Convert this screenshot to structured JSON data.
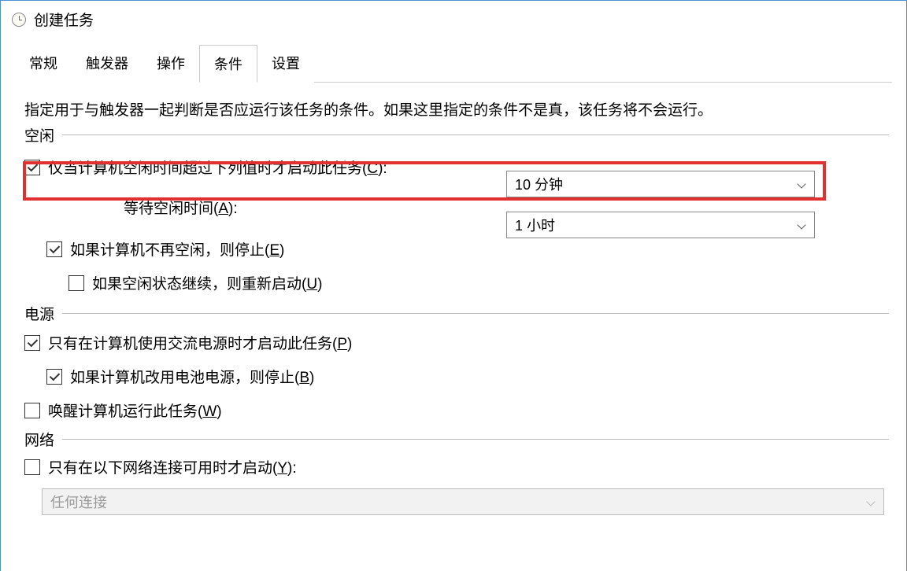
{
  "window": {
    "title": "创建任务"
  },
  "tabs": {
    "general": "常规",
    "triggers": "触发器",
    "actions": "操作",
    "conditions": "条件",
    "settings": "设置"
  },
  "active_tab": "conditions",
  "description": "指定用于与触发器一起判断是否应运行该任务的条件。如果这里指定的条件不是真，该任务将不会运行。",
  "sections": {
    "idle": {
      "label": "空闲"
    },
    "power": {
      "label": "电源"
    },
    "network": {
      "label": "网络"
    }
  },
  "options": {
    "idle_start": {
      "checked": true,
      "label_pre": "仅当计算机空闲时间超过下列值时才启动此任务(",
      "key": "C",
      "label_post": "):",
      "value": "10 分钟"
    },
    "idle_wait": {
      "label_pre": "等待空闲时间(",
      "key": "A",
      "label_post": "):",
      "value": "1 小时"
    },
    "idle_stop": {
      "checked": true,
      "label_pre": "如果计算机不再空闲，则停止(",
      "key": "E",
      "label_post": ")"
    },
    "idle_restart": {
      "checked": false,
      "label_pre": "如果空闲状态继续，则重新启动(",
      "key": "U",
      "label_post": ")"
    },
    "power_ac": {
      "checked": true,
      "label_pre": "只有在计算机使用交流电源时才启动此任务(",
      "key": "P",
      "label_post": ")"
    },
    "power_battery_stop": {
      "checked": true,
      "label_pre": "如果计算机改用电池电源，则停止(",
      "key": "B",
      "label_post": ")"
    },
    "power_wake": {
      "checked": false,
      "label_pre": "唤醒计算机运行此任务(",
      "key": "W",
      "label_post": ")"
    },
    "network_start": {
      "checked": false,
      "label_pre": "只有在以下网络连接可用时才启动(",
      "key": "Y",
      "label_post": "):"
    },
    "network_select": {
      "value": "任何连接"
    }
  }
}
